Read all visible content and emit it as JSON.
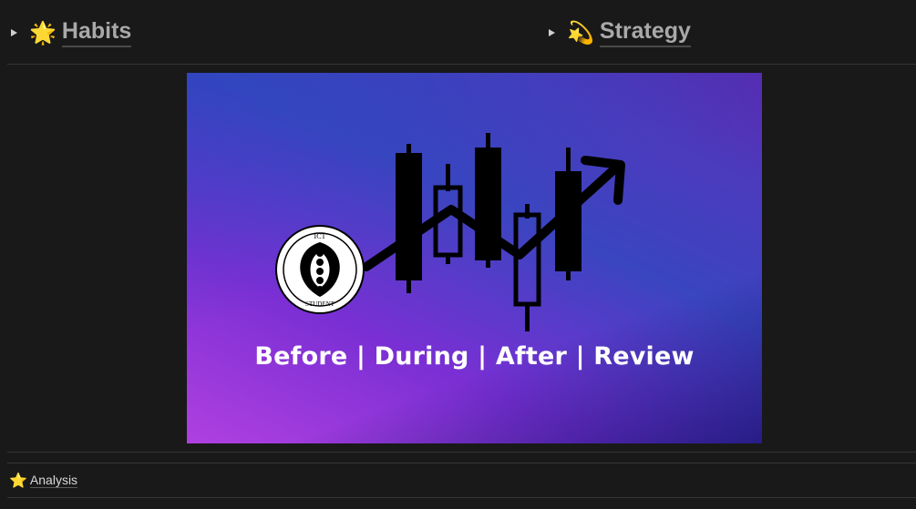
{
  "toggles": {
    "habits": {
      "emoji": "🌟",
      "label": "Habits",
      "icon": "caret-right-icon"
    },
    "strategy": {
      "emoji": "💫",
      "label": "Strategy",
      "icon": "caret-right-icon"
    }
  },
  "banner": {
    "caption": "Before | During | After | Review",
    "logo_top_text": "ICT",
    "logo_bottom_text": "STUDENT"
  },
  "analysis": {
    "emoji": "⭐",
    "label": "Analysis"
  },
  "colors": {
    "background": "#191919",
    "heading": "#a9a9a9",
    "banner_start": "#3a45c0",
    "banner_end": "#b040e0"
  }
}
